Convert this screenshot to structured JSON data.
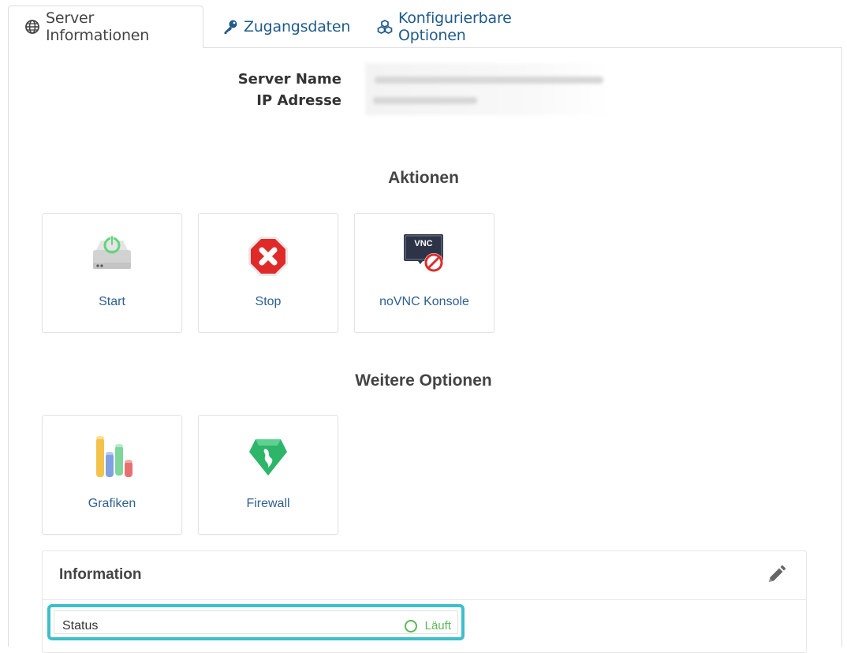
{
  "tabs": [
    {
      "label": "Server Informationen",
      "icon": "globe-icon",
      "active": true
    },
    {
      "label": "Zugangsdaten",
      "icon": "key-icon",
      "active": false
    },
    {
      "label": "Konfigurierbare Optionen",
      "icon": "cubes-icon",
      "active": false
    }
  ],
  "server_info": {
    "name_label": "Server Name",
    "ip_label": "IP Adresse"
  },
  "actions": {
    "title": "Aktionen",
    "items": [
      {
        "label": "Start",
        "icon": "power-drive-icon"
      },
      {
        "label": "Stop",
        "icon": "stop-sign-icon"
      },
      {
        "label": "noVNC Konsole",
        "icon": "vnc-console-disabled-icon",
        "badge": "VNC"
      }
    ]
  },
  "more": {
    "title": "Weitere Optionen",
    "items": [
      {
        "label": "Grafiken",
        "icon": "bar-graph-icon"
      },
      {
        "label": "Firewall",
        "icon": "firewall-shield-icon"
      }
    ]
  },
  "information": {
    "title": "Information",
    "status_label": "Status",
    "status_value": "Läuft",
    "status_color": "#5cb85c",
    "highlight_color": "#3dbfca"
  },
  "colors": {
    "link": "#2f5f8f",
    "tab_link": "#1f5a8a"
  }
}
